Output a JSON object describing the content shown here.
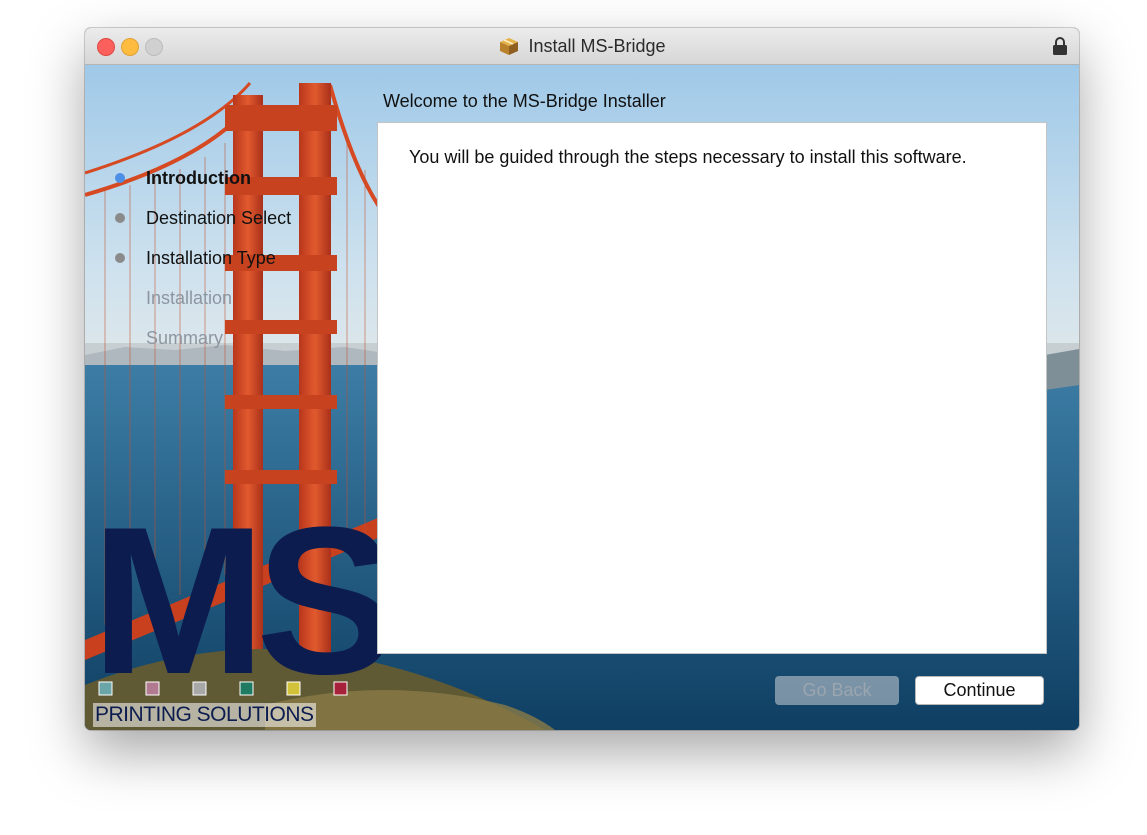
{
  "window": {
    "title": "Install MS-Bridge",
    "icon": "package-icon",
    "lock_icon": "lock-icon"
  },
  "heading": "Welcome to the MS-Bridge Installer",
  "body_text": "You will be guided through the steps necessary to install this software.",
  "steps": [
    {
      "label": "Introduction",
      "state": "current"
    },
    {
      "label": "Destination Select",
      "state": "pending"
    },
    {
      "label": "Installation Type",
      "state": "pending"
    },
    {
      "label": "Installation",
      "state": "disabled"
    },
    {
      "label": "Summary",
      "state": "disabled"
    }
  ],
  "logo": {
    "letters": "MS",
    "tagline": "PRINTING SOLUTIONS",
    "swatch_colors": [
      "#6aa5a8",
      "#b27a90",
      "#a8a8a8",
      "#1f7a63",
      "#d1c23a",
      "#a8213a"
    ]
  },
  "buttons": {
    "back": "Go Back",
    "continue": "Continue"
  },
  "colors": {
    "current_step_dot": "#4d8fe6",
    "pending_step_dot": "#8a8a8a",
    "disabled_text": "#8d96a0"
  }
}
